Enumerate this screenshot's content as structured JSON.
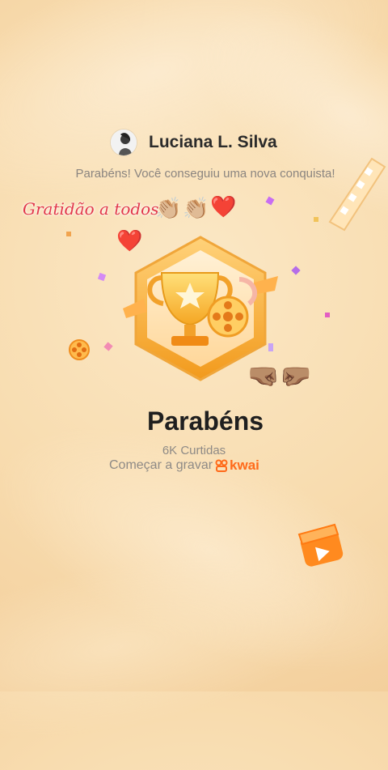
{
  "user": {
    "name": "Luciana L. Silva"
  },
  "subtitle": "Parabéns! Você conseguiu uma nova conquista!",
  "overlay": {
    "text": "Gratidão a todos"
  },
  "achievement": {
    "title": "Parabéns",
    "likes": "6K Curtidas",
    "record_label": "Começar a gravar",
    "brand": "kwai"
  },
  "icons": [
    "avatar",
    "clapping-hands-icon",
    "heart-icon",
    "trophy-badge-icon",
    "film-reel-icon",
    "fist-bump-icon",
    "kwai-logo-icon",
    "video-clapper-icon"
  ],
  "colors": {
    "accent": "#ff6a1a",
    "heart": "#e0192b",
    "overlay_text": "#e2384a"
  }
}
